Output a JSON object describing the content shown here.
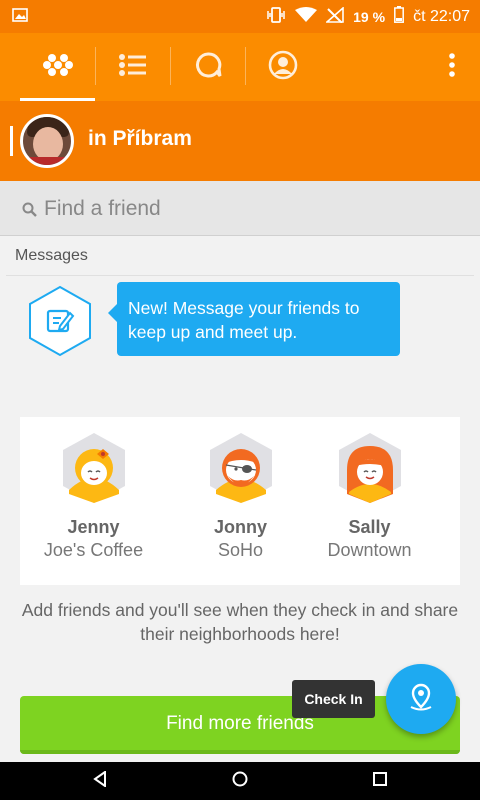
{
  "status_bar": {
    "battery_percent": "19 %",
    "time": "čt 22:07",
    "icons": [
      "image-icon",
      "vibrate-icon",
      "wifi-icon",
      "no-signal-icon",
      "battery-icon"
    ]
  },
  "nav": {
    "tabs": [
      {
        "icon": "explore-icon",
        "active": true
      },
      {
        "icon": "list-icon",
        "active": false
      },
      {
        "icon": "chat-icon",
        "active": false
      },
      {
        "icon": "profile-icon",
        "active": false
      }
    ],
    "more_icon": "more-vert-icon"
  },
  "profile": {
    "city": "in Příbram"
  },
  "search": {
    "placeholder": "Find a friend"
  },
  "messages": {
    "section_title": "Messages",
    "tooltip_text": "New! Message your friends to keep up and meet up."
  },
  "friends": [
    {
      "name": "Jenny",
      "place": "Joe's Coffee"
    },
    {
      "name": "Jonny",
      "place": "SoHo"
    },
    {
      "name": "Sally",
      "place": "Downtown"
    }
  ],
  "hint_text": "Add friends and you'll see when they check in and share their neighborhoods here!",
  "find_button_label": "Find more friends",
  "checkin_label": "Check In",
  "colors": {
    "orange_dark": "#f57c00",
    "orange": "#fb8c00",
    "blue": "#1eaaf1",
    "green": "#7ed321"
  }
}
